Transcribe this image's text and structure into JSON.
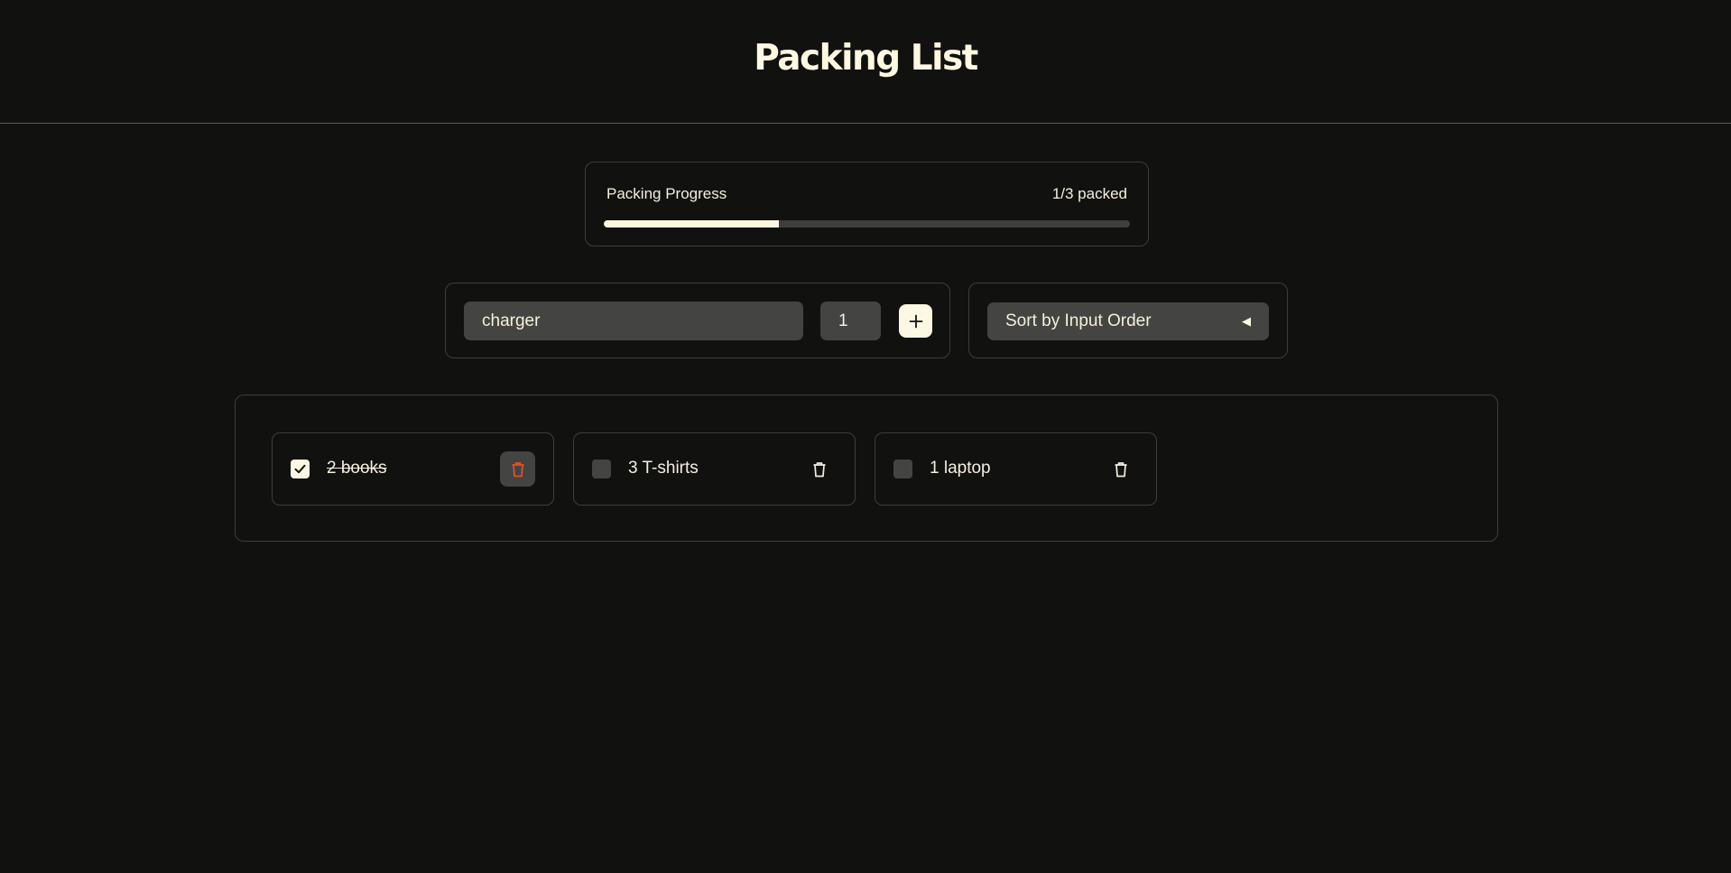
{
  "header": {
    "title": "Packing List"
  },
  "progress": {
    "label": "Packing Progress",
    "count_text": "1/3 packed",
    "fraction": 0.333
  },
  "add_form": {
    "item_value": "charger",
    "quantity_value": "1"
  },
  "sort": {
    "selected": "Sort by Input Order"
  },
  "items": [
    {
      "text": "2 books",
      "packed": true
    },
    {
      "text": "3 T-shirts",
      "packed": false
    },
    {
      "text": "1 laptop",
      "packed": false
    }
  ],
  "colors": {
    "background": "#111110",
    "accent": "#fcf8e3",
    "field": "#444442",
    "delete_active": "#e0532b",
    "border": "#3d3d3a"
  },
  "icons": {
    "add": "plus-icon",
    "sort": "triangle-left-icon",
    "check": "checkmark-icon",
    "delete": "trash-icon"
  }
}
